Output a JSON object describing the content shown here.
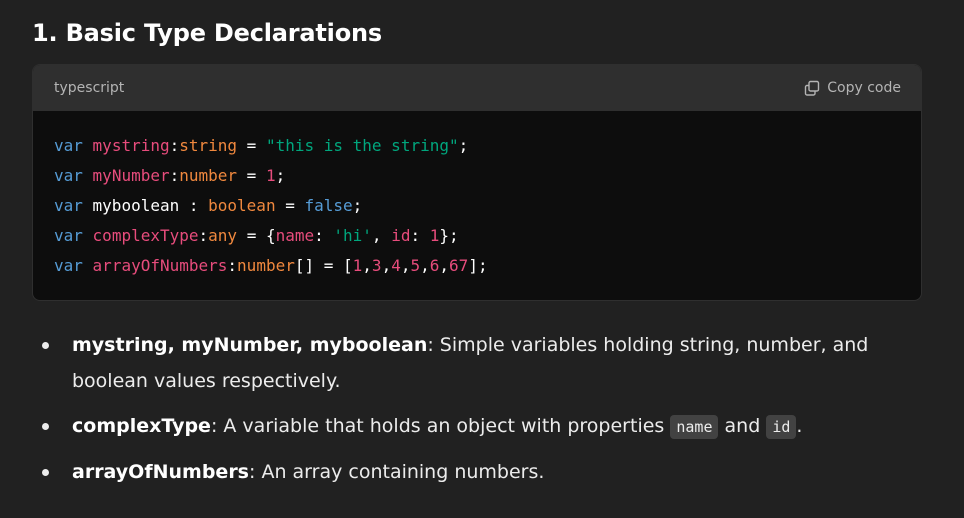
{
  "heading": "1. Basic Type Declarations",
  "code_block": {
    "language": "typescript",
    "copy_label": "Copy code",
    "copy_icon": "copy-icon",
    "lines": [
      [
        {
          "t": "var",
          "c": "kw"
        },
        {
          "t": " ",
          "c": "punc"
        },
        {
          "t": "mystring",
          "c": "var"
        },
        {
          "t": ":",
          "c": "punc"
        },
        {
          "t": "string",
          "c": "type"
        },
        {
          "t": " = ",
          "c": "punc"
        },
        {
          "t": "\"this is the string\"",
          "c": "str"
        },
        {
          "t": ";",
          "c": "punc"
        }
      ],
      [
        {
          "t": "var",
          "c": "kw"
        },
        {
          "t": " ",
          "c": "punc"
        },
        {
          "t": "myNumber",
          "c": "var"
        },
        {
          "t": ":",
          "c": "punc"
        },
        {
          "t": "number",
          "c": "type"
        },
        {
          "t": " = ",
          "c": "punc"
        },
        {
          "t": "1",
          "c": "num"
        },
        {
          "t": ";",
          "c": "punc"
        }
      ],
      [
        {
          "t": "var",
          "c": "kw"
        },
        {
          "t": " myboolean : ",
          "c": "punc"
        },
        {
          "t": "boolean",
          "c": "type"
        },
        {
          "t": " = ",
          "c": "punc"
        },
        {
          "t": "false",
          "c": "bool"
        },
        {
          "t": ";",
          "c": "punc"
        }
      ],
      [
        {
          "t": "var",
          "c": "kw"
        },
        {
          "t": " ",
          "c": "punc"
        },
        {
          "t": "complexType",
          "c": "var"
        },
        {
          "t": ":",
          "c": "punc"
        },
        {
          "t": "any",
          "c": "type"
        },
        {
          "t": " = {",
          "c": "punc"
        },
        {
          "t": "name",
          "c": "var"
        },
        {
          "t": ": ",
          "c": "punc"
        },
        {
          "t": "'hi'",
          "c": "str"
        },
        {
          "t": ", ",
          "c": "punc"
        },
        {
          "t": "id",
          "c": "var"
        },
        {
          "t": ": ",
          "c": "punc"
        },
        {
          "t": "1",
          "c": "num"
        },
        {
          "t": "};",
          "c": "punc"
        }
      ],
      [
        {
          "t": "var",
          "c": "kw"
        },
        {
          "t": " ",
          "c": "punc"
        },
        {
          "t": "arrayOfNumbers",
          "c": "var"
        },
        {
          "t": ":",
          "c": "punc"
        },
        {
          "t": "number",
          "c": "type"
        },
        {
          "t": "[] = [",
          "c": "punc"
        },
        {
          "t": "1",
          "c": "num"
        },
        {
          "t": ",",
          "c": "punc"
        },
        {
          "t": "3",
          "c": "num"
        },
        {
          "t": ",",
          "c": "punc"
        },
        {
          "t": "4",
          "c": "num"
        },
        {
          "t": ",",
          "c": "punc"
        },
        {
          "t": "5",
          "c": "num"
        },
        {
          "t": ",",
          "c": "punc"
        },
        {
          "t": "6",
          "c": "num"
        },
        {
          "t": ",",
          "c": "punc"
        },
        {
          "t": "67",
          "c": "num"
        },
        {
          "t": "];",
          "c": "punc"
        }
      ]
    ]
  },
  "bullets": [
    {
      "term": "mystring, myNumber, myboolean",
      "text": ": Simple variables holding string, number, and boolean values respectively."
    },
    {
      "term": "complexType",
      "text_before": ": A variable that holds an object with properties ",
      "code1": "name",
      "and": " and ",
      "code2": "id",
      "text_after": "."
    },
    {
      "term": "arrayOfNumbers",
      "text": ": An array containing numbers."
    }
  ],
  "colors": {
    "background": "#212121",
    "code_header": "#2f2f2f",
    "code_body": "#0d0d0d",
    "keyword": "#569cd6",
    "identifier": "#e74c7c",
    "type": "#f0883e",
    "string": "#00a67d"
  }
}
